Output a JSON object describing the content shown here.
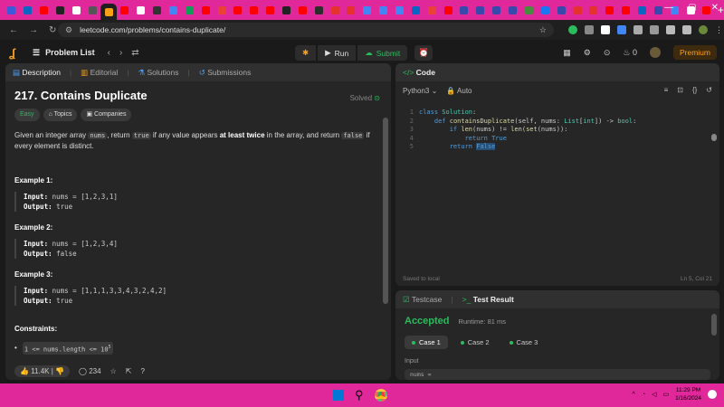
{
  "browser": {
    "url": "leetcode.com/problems/contains-duplicate/",
    "new_tab": "+",
    "window_controls": [
      "—",
      "▢",
      "✕"
    ]
  },
  "leetcode": {
    "problem_list": "Problem List",
    "run": "Run",
    "submit": "Submit",
    "streak": "0",
    "premium": "Premium"
  },
  "left_tabs": {
    "description": "Description",
    "editorial": "Editorial",
    "solutions": "Solutions",
    "submissions": "Submissions"
  },
  "problem": {
    "title": "217. Contains Duplicate",
    "status": "Solved",
    "difficulty": "Easy",
    "topics": "Topics",
    "companies": "Companies",
    "desc_1": "Given an integer array ",
    "desc_code_1": "nums",
    "desc_2": ", return ",
    "desc_code_2": "true",
    "desc_3": " if any value appears ",
    "desc_bold": "at least twice",
    "desc_4": " in the array, and return ",
    "desc_code_3": "false",
    "desc_5": " if every element is distinct.",
    "examples": [
      {
        "label": "Example 1:",
        "input": "nums = [1,2,3,1]",
        "output": "true"
      },
      {
        "label": "Example 2:",
        "input": "nums = [1,2,3,4]",
        "output": "false"
      },
      {
        "label": "Example 3:",
        "input": "nums = [1,1,1,3,3,4,3,2,4,2]",
        "output": "true"
      }
    ],
    "input_label": "Input:",
    "output_label": "Output:",
    "constraints_label": "Constraints:",
    "constraint_1": "1 <= nums.length <= 10",
    "constraint_1_exp": "5",
    "likes": "11.4K",
    "comments": "234"
  },
  "code_panel": {
    "title": "Code",
    "language": "Python3",
    "auto": "Auto",
    "line_numbers": [
      "1",
      "2",
      "3",
      "4",
      "5"
    ],
    "saved": "Saved to local",
    "position": "Ln 5, Col 21"
  },
  "result_panel": {
    "testcase_tab": "Testcase",
    "result_tab": "Test Result",
    "accepted": "Accepted",
    "runtime": "Runtime: 81 ms",
    "cases": [
      "Case 1",
      "Case 2",
      "Case 3"
    ],
    "input_label": "Input",
    "input_value": "nums ="
  },
  "taskbar": {
    "time": "11:29 PM",
    "date": "1/16/2024"
  },
  "colors": {
    "accent_pink": "#e0289a",
    "leetcode_orange": "#ffa116",
    "accepted_green": "#2cbb5d"
  }
}
